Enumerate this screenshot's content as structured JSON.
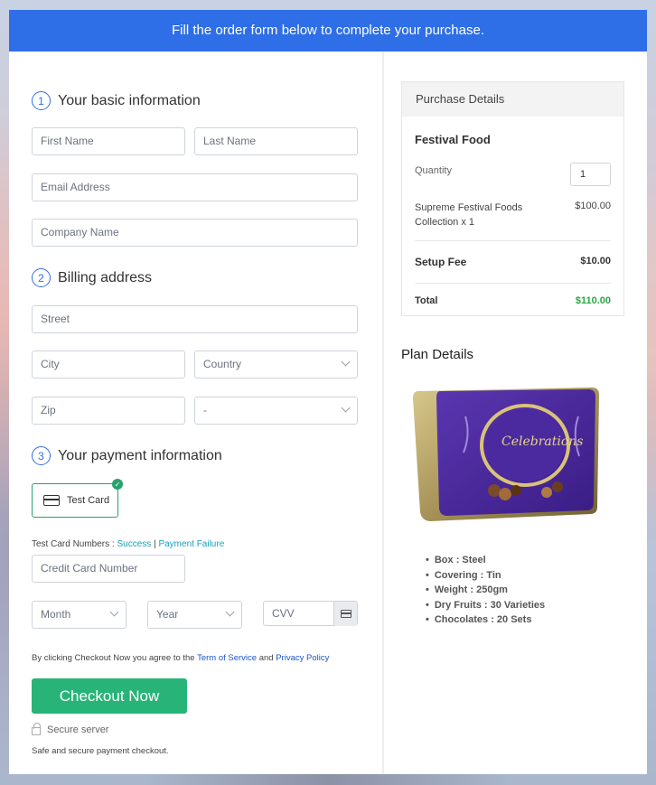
{
  "banner": "Fill the order form below to complete your purchase.",
  "sections": {
    "basic": {
      "num": "1",
      "title": "Your basic information"
    },
    "billing": {
      "num": "2",
      "title": "Billing address"
    },
    "payment": {
      "num": "3",
      "title": "Your payment information"
    }
  },
  "fields": {
    "first_name": "First Name",
    "last_name": "Last Name",
    "email": "Email Address",
    "company": "Company Name",
    "street": "Street",
    "city": "City",
    "country": "Country",
    "zip": "Zip",
    "state": "-",
    "credit_card": "Credit Card Number",
    "month": "Month",
    "year": "Year",
    "cvv": "CVV"
  },
  "payment": {
    "test_card": "Test Card",
    "test_numbers_label": "Test Card Numbers :",
    "success": "Success",
    "separator": "|",
    "failure": "Payment Failure"
  },
  "terms": {
    "prefix": "By clicking Checkout Now you agree to the",
    "tos": "Term of Service",
    "and": "and",
    "privacy": "Privacy Policy"
  },
  "checkout_button": "Checkout Now",
  "secure_server": "Secure server",
  "safe_text": "Safe and secure payment checkout.",
  "purchase": {
    "header": "Purchase Details",
    "product_name": "Festival Food",
    "quantity_label": "Quantity",
    "quantity_value": "1",
    "item_line1": "Supreme Festival Foods",
    "item_line2": "Collection x 1",
    "item_price": "$100.00",
    "setup_label": "Setup Fee",
    "setup_price": "$10.00",
    "total_label": "Total",
    "total_price": "$110.00",
    "total_color": "#28a745"
  },
  "plan": {
    "title": "Plan Details",
    "image_alt": "Cadbury Celebrations tin",
    "image_text": "Celebrations",
    "specs": [
      "Box : Steel",
      "Covering : Tin",
      "Weight : 250gm",
      "Dry Fruits : 30 Varieties",
      "Chocolates : 20 Sets"
    ]
  },
  "colors": {
    "banner": "#2e6ee6",
    "button": "#28b478",
    "accent_green": "#28a26c"
  }
}
